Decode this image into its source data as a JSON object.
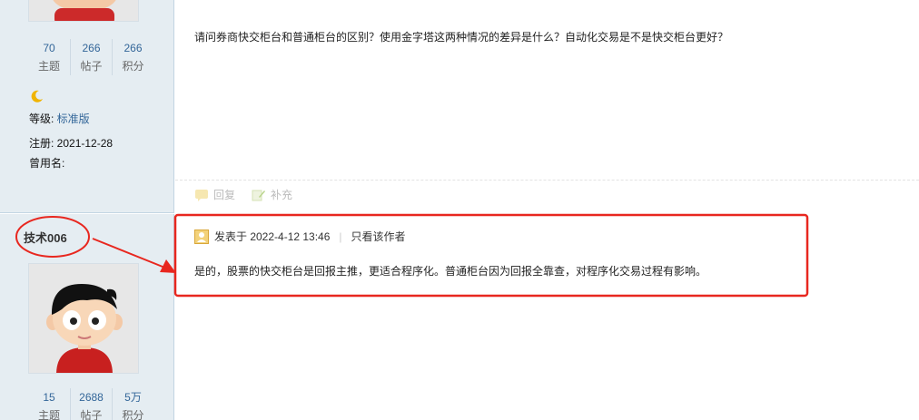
{
  "post1": {
    "stats": [
      {
        "value": "70",
        "label": "主题"
      },
      {
        "value": "266",
        "label": "帖子"
      },
      {
        "value": "266",
        "label": "积分"
      }
    ],
    "level_label": "等级: ",
    "level_value": "标准版",
    "register": "注册: 2021-12-28",
    "alias": "曾用名:",
    "content": "请问券商快交柜台和普通柜台的区别？使用金字塔这两种情况的差异是什么？自动化交易是不是快交柜台更好？",
    "actions": {
      "reply": "回复",
      "supplement": "补充"
    }
  },
  "post2": {
    "username": "技术006",
    "posted_at": "发表于 2022-4-12 13:46",
    "separator": "|",
    "author_only": "只看该作者",
    "content": "是的，股票的快交柜台是回报主推，更适合程序化。普通柜台因为回报全靠查，对程序化交易过程有影响。",
    "stats": [
      {
        "value": "15",
        "label": "主题"
      },
      {
        "value": "2688",
        "label": "帖子"
      },
      {
        "value": "5万",
        "label": "积分"
      }
    ]
  },
  "colors": {
    "sidebar_bg": "#e5edf2",
    "link": "#336699",
    "annotation_red": "#e8271f"
  }
}
